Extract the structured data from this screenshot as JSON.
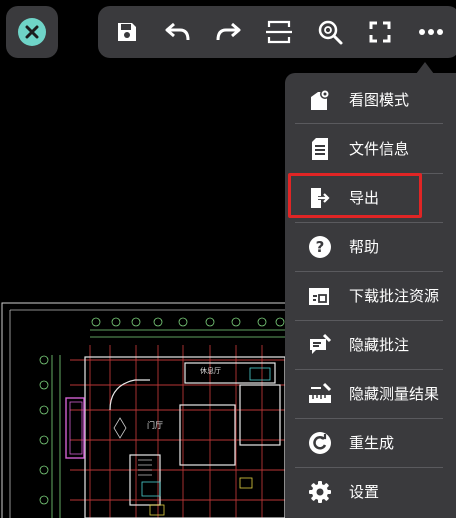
{
  "menu": {
    "items": [
      {
        "label": "看图模式",
        "icon": "view-mode-icon"
      },
      {
        "label": "文件信息",
        "icon": "file-info-icon"
      },
      {
        "label": "导出",
        "icon": "export-icon"
      },
      {
        "label": "帮助",
        "icon": "help-icon"
      },
      {
        "label": "下载批注资源",
        "icon": "download-annotation-icon"
      },
      {
        "label": "隐藏批注",
        "icon": "hide-annotation-icon"
      },
      {
        "label": "隐藏测量结果",
        "icon": "hide-measure-icon"
      },
      {
        "label": "重生成",
        "icon": "regenerate-icon"
      },
      {
        "label": "设置",
        "icon": "settings-icon"
      }
    ],
    "highlighted_item": "导出"
  },
  "toolbar": {
    "icons": [
      "save-icon",
      "undo-icon",
      "redo-icon",
      "crop-icon",
      "zoom-icon",
      "fullscreen-icon",
      "more-icon"
    ]
  },
  "drawing": {
    "labels": {
      "lobby": "门厅",
      "lounge": "休息厅"
    }
  },
  "colors": {
    "panel": "#3a3a3d",
    "accent": "#6fd4c8",
    "highlight_border": "#e02525"
  }
}
